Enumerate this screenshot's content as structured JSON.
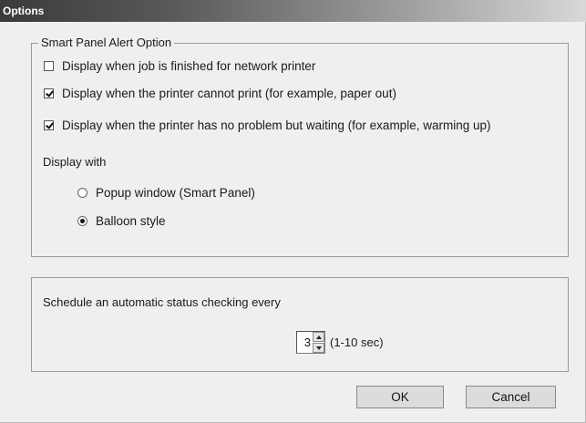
{
  "window": {
    "title": "Options"
  },
  "alert_group": {
    "legend": "Smart Panel Alert Option",
    "checkboxes": [
      {
        "label": "Display when job is finished for network printer",
        "checked": false
      },
      {
        "label": "Display when the printer cannot print (for example, paper out)",
        "checked": true
      },
      {
        "label": "Display when the printer has no problem but waiting (for example, warming up)",
        "checked": true
      }
    ],
    "display_with_label": "Display with",
    "radios": [
      {
        "label": "Popup window (Smart Panel)",
        "selected": false
      },
      {
        "label": "Balloon style",
        "selected": true
      }
    ]
  },
  "schedule_group": {
    "label": "Schedule an automatic status checking every",
    "value": "3",
    "range_label": "(1-10 sec)"
  },
  "buttons": {
    "ok": "OK",
    "cancel": "Cancel"
  }
}
